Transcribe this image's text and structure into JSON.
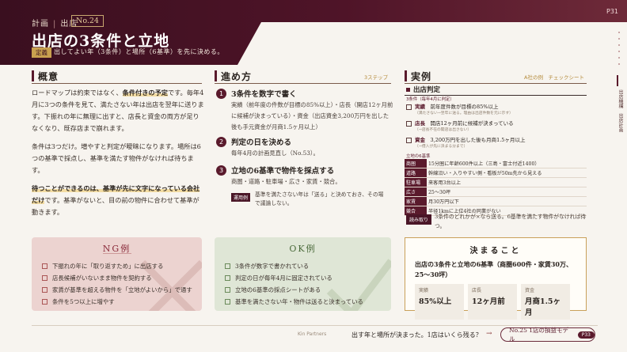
{
  "header": {
    "category_a": "計画",
    "category_b": "出店",
    "chapter": "No.24",
    "title": "出店の3条件と立地",
    "def_tag": "定義",
    "def_text": "出してよい年（3条件）と場所（6基準）を先に決める。",
    "page_no": "P31"
  },
  "vnav": {
    "dots": 6,
    "items": [
      "出店機構",
      "出店計画"
    ]
  },
  "gaiyo": {
    "title": "概意",
    "p1_a": "ロードマップは約束ではなく、",
    "p1_hl": "条件付きの予定",
    "p1_b": "です。毎年4月に3つの条件を見て、満たさない年は出店を翌年に送ります。下振れの年に無理に出すと、店長と資金の両方が足りなくなり、既存店まで崩れます。",
    "p2": "条件は3つだけ。増やすと判定が曖昧になります。場所は6つの基準で採点し、基準を満たす物件がなければ待ちます。",
    "p3_hl": "待つことができるのは、基準が先に文字になっている会社だけ",
    "p3_b": "です。基準がないと、目の前の物件に合わせて基準が動きます。"
  },
  "susumekata": {
    "title": "進め方",
    "sub": "3ステップ",
    "steps": [
      {
        "n": "1",
        "title": "3条件を数字で書く",
        "body": "実績（前年度の件数が目標の85%以上）・店長（開店12ヶ月前に候補が決まっている）・資金（出店資金3,200万円を出した後も手元資金が月商1.5ヶ月以上）"
      },
      {
        "n": "2",
        "title": "判定の日を決める",
        "body": "毎年4月の計画見直し（No.53）。"
      },
      {
        "n": "3",
        "title": "立地の6基準で物件を採点する",
        "body": "商圏・道路・駐車場・広さ・家賃・競合。"
      }
    ],
    "tag": "運用例",
    "note": "基準を満たさない年は「送る」と決めておき、その場で議論しない。"
  },
  "jitsurei": {
    "title": "実例",
    "sub": "A社の例　チェックシート",
    "head": "出店判定",
    "s1": "3条件（毎年4月に判定）",
    "rows": [
      {
        "k": "実績",
        "t": "前年度件数が目標の85%以上",
        "s": "（満たさない→翌年に送る。理由は出店件数を元に示す）"
      },
      {
        "k": "店長",
        "t": "開店12ヶ月前に候補が決まっている",
        "s": "（→店長不在の開店は出さない）"
      },
      {
        "k": "資金",
        "t": "3,200万円を出した後も月商1.5ヶ月以上",
        "s": "（→借入が先に決まる分まで）"
      }
    ],
    "s2": "立地の6基準",
    "table": [
      [
        "商圏",
        "15分圏に年齢600件以上（三島・富士付近1400）"
      ],
      [
        "道路",
        "幹線沿い・入りやすい側・看板が50m先から見える"
      ],
      [
        "駐車場",
        "来客用3台以上"
      ],
      [
        "広さ",
        "25〜30坪"
      ],
      [
        "家賃",
        "月30万円以下"
      ],
      [
        "競合",
        "半径1kmに上位4社の同業がない"
      ]
    ],
    "tag": "読み取り",
    "note": "3条件のどれかが×なら送る。6基準を満たす物件がなければ待つ。"
  },
  "ng": {
    "title": "NG例",
    "items": [
      "下振れの年に「取り返すため」に出店する",
      "店長候補がいないまま物件を契約する",
      "家賃が基準を超える物件を「立地がよいから」で通す",
      "条件を5つ以上に増やす"
    ]
  },
  "ok": {
    "title": "OK例",
    "items": [
      "3条件が数字で書かれている",
      "判定の日が毎年4月に固定されている",
      "立地の6基準の採点シートがある",
      "基準を満たさない年・物件は送ると決まっている"
    ]
  },
  "decide": {
    "title": "決まること",
    "text": "出店の3条件と立地の6基準（商圏600件・家賃30万、25〜30坪）",
    "cards": [
      {
        "l": "実績",
        "v": "85%以上"
      },
      {
        "l": "店長",
        "v": "12ヶ月前"
      },
      {
        "l": "資金",
        "v": "月商1.5ヶ月"
      }
    ]
  },
  "footer": {
    "brand": "Kin Partners",
    "question": "出す年と場所が決まった。1店はいくら残る？",
    "next": "No.25 1店の損益モデル",
    "next_page": "P33"
  },
  "colors": {
    "header": "#4f1428",
    "accent": "#5a1a2c",
    "gold": "#c9a14f"
  }
}
